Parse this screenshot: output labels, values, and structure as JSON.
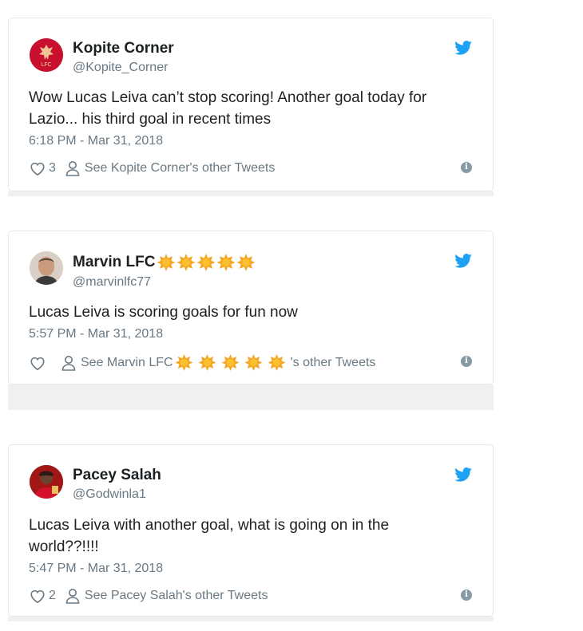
{
  "tweets": [
    {
      "display_name": "Kopite Corner",
      "handle": "@Kopite_Corner",
      "avatar_label": "LFC",
      "text": "Wow Lucas Leiva can’t stop scoring! Another goal today for Lazio... his third goal in recent times",
      "timestamp": "6:18 PM - Mar 31, 2018",
      "likes": "3",
      "other_tweets": "See Kopite Corner's other Tweets"
    },
    {
      "display_name": "Marvin LFC",
      "handle": "@marvinlfc77",
      "text": "Lucas Leiva is scoring goals for fun now",
      "timestamp": "5:57 PM - Mar 31, 2018",
      "likes": "",
      "other_tweets_prefix": "See Marvin LFC",
      "other_tweets_suffix": "'s other Tweets",
      "star_count": 5
    },
    {
      "display_name": "Pacey Salah",
      "handle": "@Godwinla1",
      "text": "Lucas Leiva with another goal, what is going on in the world??!!!!",
      "timestamp": "5:47 PM - Mar 31, 2018",
      "likes": "2",
      "other_tweets": "See Pacey Salah's other Tweets"
    }
  ],
  "colors": {
    "twitter_blue": "#1da1f2",
    "star_orange": "#f5a623",
    "lfc_red": "#c8102e"
  }
}
